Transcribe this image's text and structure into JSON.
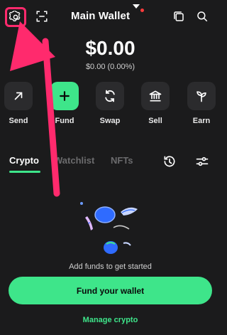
{
  "header": {
    "title": "Main Wallet",
    "icons": {
      "settings": "gear-icon",
      "scan": "scan-icon",
      "copy": "copy-icon",
      "search": "search-icon"
    }
  },
  "balance": {
    "amount": "$0.00",
    "change": "$0.00 (0.00%)"
  },
  "actions": [
    {
      "label": "Send",
      "icon": "arrow-up-right-icon"
    },
    {
      "label": "Fund",
      "icon": "plus-icon"
    },
    {
      "label": "Swap",
      "icon": "swap-icon"
    },
    {
      "label": "Sell",
      "icon": "bank-icon"
    },
    {
      "label": "Earn",
      "icon": "sprout-icon"
    }
  ],
  "tabs": [
    {
      "label": "Crypto"
    },
    {
      "label": "Watchlist"
    },
    {
      "label": "NFTs"
    }
  ],
  "empty_state": {
    "message": "Add funds to get started"
  },
  "primary_button": {
    "label": "Fund your wallet"
  },
  "manage_link": {
    "label": "Manage crypto"
  },
  "colors": {
    "background": "#1b1b1c",
    "accent": "#3ee58a",
    "annotation": "#ff2a6d"
  }
}
